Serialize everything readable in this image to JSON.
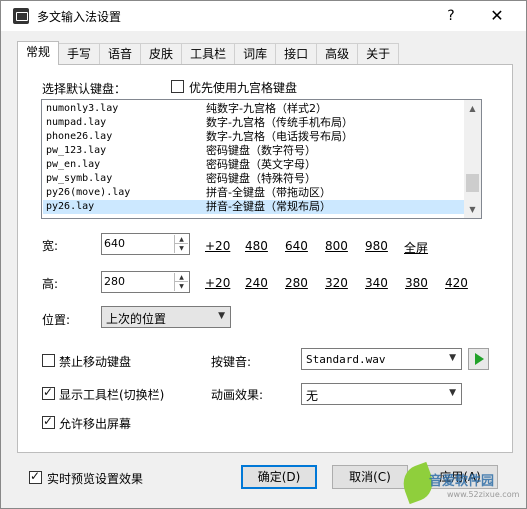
{
  "window": {
    "title": "多文输入法设置",
    "help": "?",
    "close": "✕"
  },
  "tabs": [
    "常规",
    "手写",
    "语音",
    "皮肤",
    "工具栏",
    "词库",
    "接口",
    "高级",
    "关于"
  ],
  "general": {
    "keyboard_label": "选择默认键盘：",
    "nine_grid_label": "优先使用九宫格键盘",
    "nine_grid_checked": false,
    "keyboards": [
      {
        "file": "numonly3.lay",
        "desc": "纯数字-九宫格（样式2）"
      },
      {
        "file": "numpad.lay",
        "desc": "数字-九宫格（传统手机布局）"
      },
      {
        "file": "phone26.lay",
        "desc": "数字-九宫格（电话拨号布局）"
      },
      {
        "file": "pw_123.lay",
        "desc": "密码键盘（数字符号）"
      },
      {
        "file": "pw_en.lay",
        "desc": "密码键盘（英文字母）"
      },
      {
        "file": "pw_symb.lay",
        "desc": "密码键盘（特殊符号）"
      },
      {
        "file": "py26(move).lay",
        "desc": "拼音-全键盘（带拖动区）"
      },
      {
        "file": "py26.lay",
        "desc": "拼音-全键盘（常规布局）"
      }
    ],
    "selected_index": 7,
    "width_label": "宽:",
    "width_value": "640",
    "width_presets": [
      "+20",
      "480",
      "640",
      "800",
      "980",
      "全屏"
    ],
    "height_label": "高:",
    "height_value": "280",
    "height_presets": [
      "+20",
      "240",
      "280",
      "320",
      "340",
      "380",
      "420"
    ],
    "position_label": "位置:",
    "position_value": "上次的位置",
    "no_move_label": "禁止移动键盘",
    "no_move_checked": false,
    "show_toolbar_label": "显示工具栏(切换栏)",
    "show_toolbar_checked": true,
    "allow_offscreen_label": "允许移出屏幕",
    "allow_offscreen_checked": true,
    "key_sound_label": "按键音:",
    "key_sound_value": "Standard.wav",
    "animation_label": "动画效果:",
    "animation_value": "无"
  },
  "footer": {
    "preview_label": "实时预览设置效果",
    "preview_checked": true,
    "ok": "确定(D)",
    "cancel": "取消(C)",
    "apply": "应用(A)"
  },
  "watermark": {
    "text": "音爱软件园",
    "sub": "www.52zixue.com"
  },
  "colors": {
    "selection": "#cce8ff",
    "play": "#22a22a",
    "default_border": "#0078d7"
  }
}
